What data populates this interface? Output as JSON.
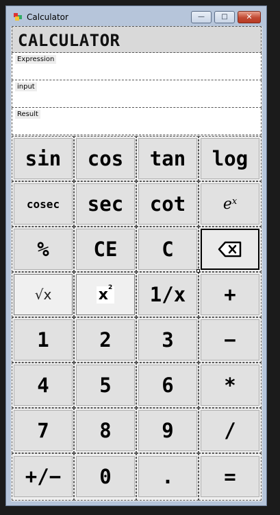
{
  "window": {
    "title": "Calculator",
    "controls": {
      "minimize": "—",
      "maximize": "□",
      "close": "✕"
    }
  },
  "header": {
    "title": "CALCULATOR"
  },
  "fields": {
    "expression_label": "Expression",
    "input_label": "input",
    "result_label": "Result"
  },
  "keypad": {
    "rows": [
      [
        "sin",
        "cos",
        "tan",
        "log"
      ],
      [
        "cosec",
        "sec",
        "cot",
        "e^x"
      ],
      [
        "%",
        "CE",
        "C",
        "backspace"
      ],
      [
        "√x",
        "x²",
        "1/x",
        "+"
      ],
      [
        "1",
        "2",
        "3",
        "−"
      ],
      [
        "4",
        "5",
        "6",
        "*"
      ],
      [
        "7",
        "8",
        "9",
        "/"
      ],
      [
        "+/−",
        "0",
        ".",
        "="
      ]
    ],
    "ex_base": "e",
    "ex_exp": "x",
    "sqrt_text": "√x",
    "sq_base": "x",
    "sq_exp": "2"
  },
  "colors": {
    "title_bar": "#b6c5da",
    "close_button": "#c24a33",
    "button_face": "#e1e1e1",
    "client_bg": "#f0f0f0"
  }
}
